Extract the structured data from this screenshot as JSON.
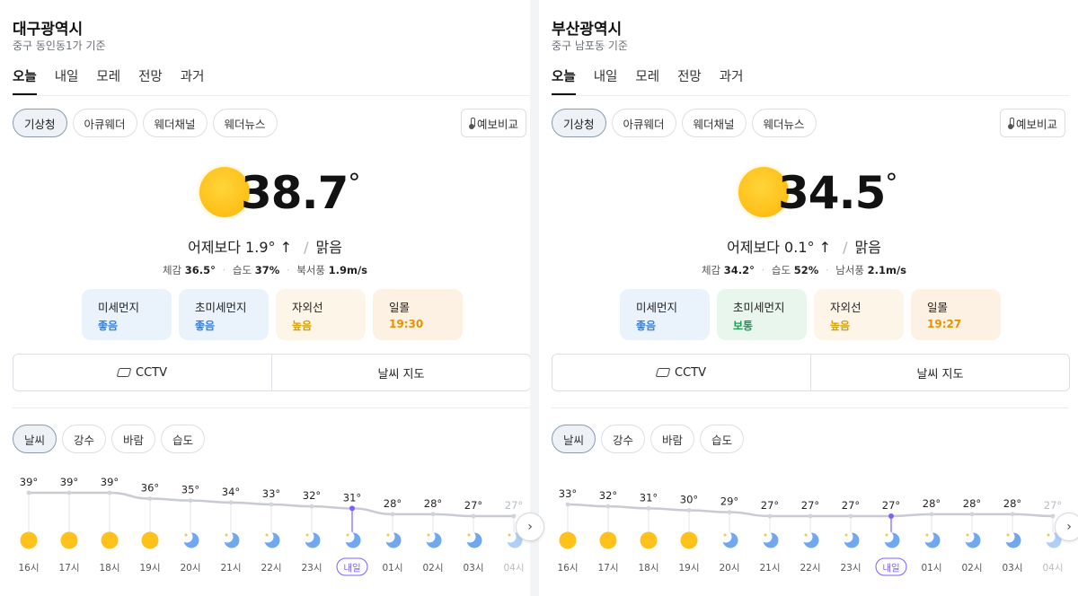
{
  "panels": [
    {
      "city": "대구광역시",
      "location": "중구 동인동1가 기준",
      "tabs": [
        "오늘",
        "내일",
        "모레",
        "전망",
        "과거"
      ],
      "sources": [
        "기상청",
        "아큐웨더",
        "웨더채널",
        "웨더뉴스"
      ],
      "compare_label": "예보비교",
      "current_temp": "38.7",
      "degree": "°",
      "vs_yesterday_label": "어제보다",
      "vs_yesterday_value": "1.9° ↑",
      "condition": "맑음",
      "feels_label": "체감",
      "feels_value": "36.5°",
      "humidity_label": "습도",
      "humidity_value": "37%",
      "wind_label": "북서풍",
      "wind_value": "1.9m/s",
      "cards": [
        {
          "label": "미세먼지",
          "value": "좋음",
          "style": "blue"
        },
        {
          "label": "초미세먼지",
          "value": "좋음",
          "style": "blue"
        },
        {
          "label": "자외선",
          "value": "높음",
          "style": "cream"
        },
        {
          "label": "일몰",
          "value": "19:30",
          "style": "peach"
        }
      ],
      "cctv_label": "CCTV",
      "map_label": "날씨 지도",
      "metric_tabs": [
        "날씨",
        "강수",
        "바람",
        "습도"
      ],
      "hourly": {
        "times": [
          "16시",
          "17시",
          "18시",
          "19시",
          "20시",
          "21시",
          "22시",
          "23시",
          "내일",
          "01시",
          "02시",
          "03시",
          "04시"
        ],
        "temp_labels": [
          "39°",
          "39°",
          "39°",
          "36°",
          "35°",
          "34°",
          "33°",
          "32°",
          "31°",
          "28°",
          "28°",
          "27°",
          "27°"
        ],
        "temps": [
          39,
          39,
          39,
          36,
          35,
          34,
          33,
          32,
          31,
          28,
          28,
          27,
          27
        ],
        "icons": [
          "sun",
          "sun",
          "sun",
          "sun",
          "moon",
          "moon",
          "moon",
          "moon",
          "moon",
          "moon",
          "moon",
          "moon",
          "moon"
        ],
        "highlight_index": 8
      }
    },
    {
      "city": "부산광역시",
      "location": "중구 남포동 기준",
      "tabs": [
        "오늘",
        "내일",
        "모레",
        "전망",
        "과거"
      ],
      "sources": [
        "기상청",
        "아큐웨더",
        "웨더채널",
        "웨더뉴스"
      ],
      "compare_label": "예보비교",
      "current_temp": "34.5",
      "degree": "°",
      "vs_yesterday_label": "어제보다",
      "vs_yesterday_value": "0.1° ↑",
      "condition": "맑음",
      "feels_label": "체감",
      "feels_value": "34.2°",
      "humidity_label": "습도",
      "humidity_value": "52%",
      "wind_label": "남서풍",
      "wind_value": "2.1m/s",
      "cards": [
        {
          "label": "미세먼지",
          "value": "좋음",
          "style": "blue"
        },
        {
          "label": "초미세먼지",
          "value": "보통",
          "style": "green"
        },
        {
          "label": "자외선",
          "value": "높음",
          "style": "cream"
        },
        {
          "label": "일몰",
          "value": "19:27",
          "style": "peach"
        }
      ],
      "cctv_label": "CCTV",
      "map_label": "날씨 지도",
      "metric_tabs": [
        "날씨",
        "강수",
        "바람",
        "습도"
      ],
      "hourly": {
        "times": [
          "16시",
          "17시",
          "18시",
          "19시",
          "20시",
          "21시",
          "22시",
          "23시",
          "내일",
          "01시",
          "02시",
          "03시",
          "04시"
        ],
        "temp_labels": [
          "33°",
          "32°",
          "31°",
          "30°",
          "29°",
          "27°",
          "27°",
          "27°",
          "27°",
          "28°",
          "28°",
          "28°",
          "27°"
        ],
        "temps": [
          33,
          32,
          31,
          30,
          29,
          27,
          27,
          27,
          27,
          28,
          28,
          28,
          27
        ],
        "icons": [
          "sun",
          "sun",
          "sun",
          "sun",
          "moon",
          "moon",
          "moon",
          "moon",
          "moon",
          "moon",
          "moon",
          "moon",
          "moon"
        ],
        "highlight_index": 8
      }
    }
  ],
  "next_icon": "chevron-right-icon",
  "colors": {
    "accent": "#7b61ff",
    "line": "#c8cbd2",
    "sun": "#ffc21c",
    "moon": "#6fa8ef"
  }
}
